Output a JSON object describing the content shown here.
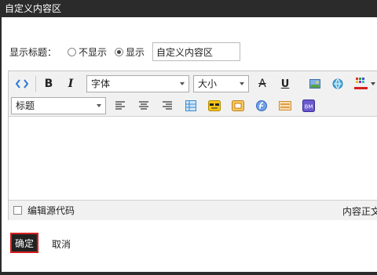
{
  "window": {
    "title": "自定义内容区"
  },
  "title_setting": {
    "label": "显示标题：",
    "options": [
      "不显示",
      "显示"
    ],
    "selected": "显示",
    "input_value": "自定义内容区"
  },
  "toolbar": {
    "font_select": "字体",
    "size_select": "大小",
    "heading_select": "标题",
    "bold": "B",
    "italic": "I",
    "underline": "U",
    "strike": "A",
    "bm_badge": "BM"
  },
  "status": {
    "checkbox_label": "编辑源代码",
    "right_text": "内容正文"
  },
  "buttons": {
    "ok": "确定",
    "cancel": "取消"
  },
  "colors": {
    "titlebar": "#2b2b2b",
    "toolbar_bg": "#f1f1f1",
    "ok_border": "#d62020",
    "ok_bg": "#222222",
    "color_underline": "#d62020"
  }
}
